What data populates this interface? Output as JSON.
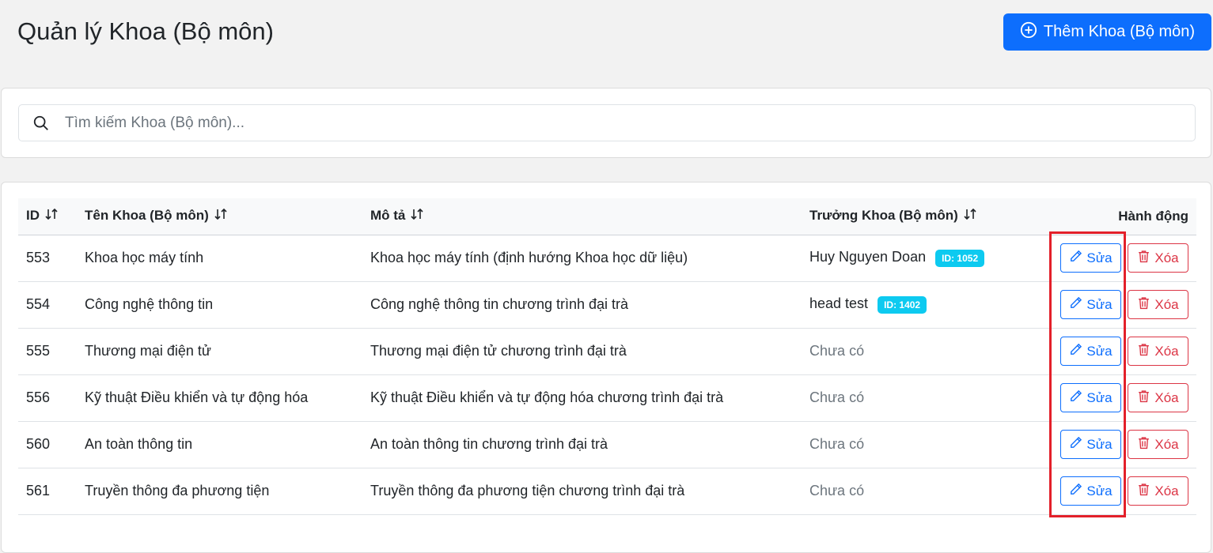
{
  "page": {
    "title": "Quản lý Khoa (Bộ môn)",
    "add_button_label": "Thêm Khoa (Bộ môn)"
  },
  "search": {
    "placeholder": "Tìm kiếm Khoa (Bộ môn)...",
    "value": ""
  },
  "table": {
    "headers": {
      "id": "ID",
      "name": "Tên Khoa (Bộ môn)",
      "description": "Mô tả",
      "head": "Trưởng Khoa (Bộ môn)",
      "actions": "Hành động"
    },
    "edit_label": "Sửa",
    "delete_label": "Xóa",
    "rows": [
      {
        "id": "553",
        "name": "Khoa học máy tính",
        "description": "Khoa học máy tính (định hướng Khoa học dữ liệu)",
        "head": "Huy Nguyen Doan",
        "head_badge": "ID: 1052",
        "head_missing": false
      },
      {
        "id": "554",
        "name": "Công nghệ thông tin",
        "description": "Công nghệ thông tin chương trình đại trà",
        "head": "head test",
        "head_badge": "ID: 1402",
        "head_missing": false
      },
      {
        "id": "555",
        "name": "Thương mại điện tử",
        "description": "Thương mại điện tử chương trình đại trà",
        "head": "Chưa có",
        "head_badge": "",
        "head_missing": true
      },
      {
        "id": "556",
        "name": "Kỹ thuật Điều khiển và tự động hóa",
        "description": "Kỹ thuật Điều khiển và tự động hóa chương trình đại trà",
        "head": "Chưa có",
        "head_badge": "",
        "head_missing": true
      },
      {
        "id": "560",
        "name": "An toàn thông tin",
        "description": "An toàn thông tin chương trình đại trà",
        "head": "Chưa có",
        "head_badge": "",
        "head_missing": true
      },
      {
        "id": "561",
        "name": "Truyền thông đa phương tiện",
        "description": "Truyền thông đa phương tiện chương trình đại trà",
        "head": "Chưa có",
        "head_badge": "",
        "head_missing": true
      }
    ]
  },
  "colors": {
    "primary": "#0d6efd",
    "danger": "#dc3545",
    "info_badge": "#0dcaf0",
    "highlight": "#e3202a"
  },
  "icons": {
    "add": "plus-circle-icon",
    "search": "search-icon",
    "sort": "sort-icon",
    "edit": "pencil-icon",
    "delete": "trash-icon"
  }
}
